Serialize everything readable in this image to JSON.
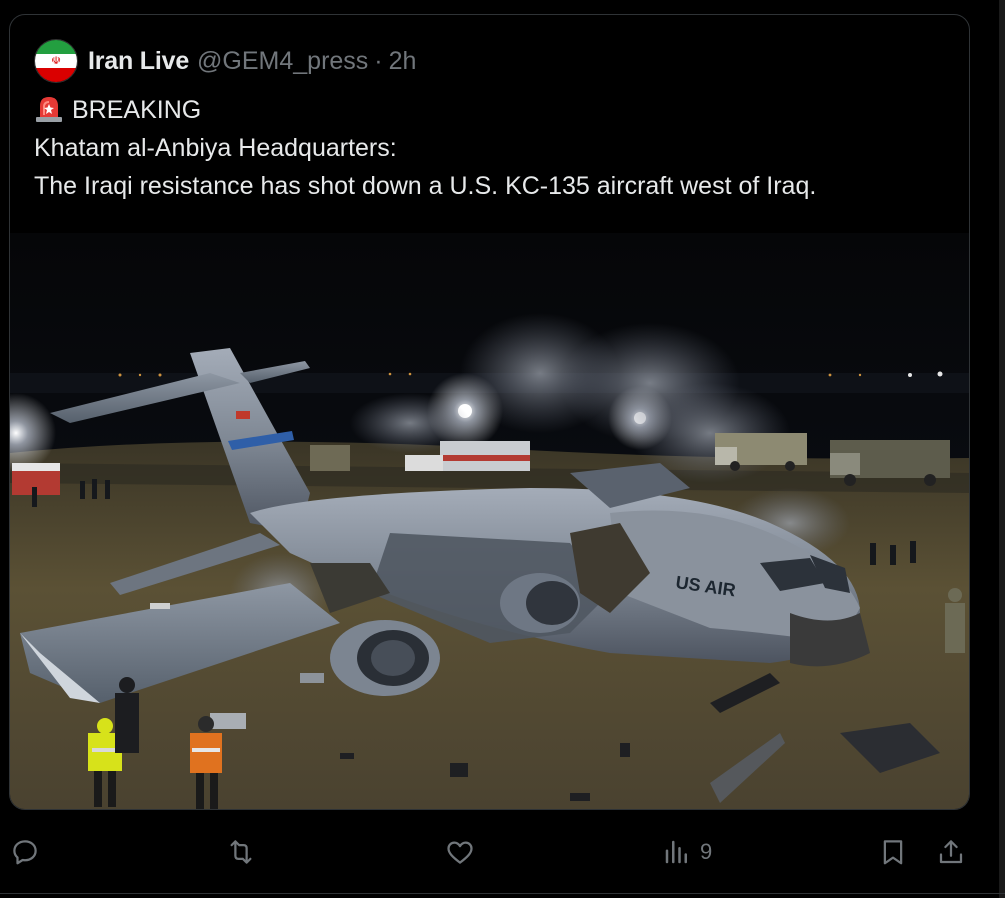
{
  "post": {
    "author_name": "Iran Live",
    "author_handle": "@GEM4_press",
    "separator": "·",
    "time": "2h",
    "avatar_icon": "iran-flag-icon",
    "siren_icon": "police-light-emoji",
    "breaking_label": "BREAKING",
    "line2": "Khatam al-Anbiya Headquarters:",
    "line3": "The Iraqi resistance has shot down a U.S. KC-135 aircraft west of Iraq.",
    "image_text": "US AIR"
  },
  "actions": {
    "reply_icon": "reply-icon",
    "repost_icon": "repost-icon",
    "like_icon": "heart-icon",
    "views_icon": "views-icon",
    "views_count": "9",
    "bookmark_icon": "bookmark-icon",
    "share_icon": "share-icon"
  },
  "colors": {
    "background": "#000000",
    "text": "#e7e9ea",
    "muted": "#71767b",
    "border": "#2f3336"
  }
}
